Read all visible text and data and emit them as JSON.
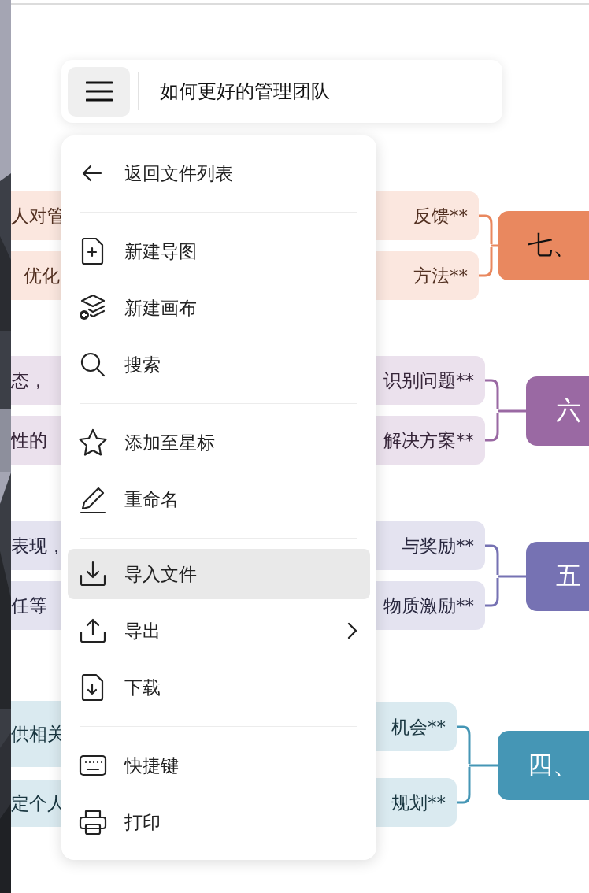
{
  "document": {
    "title": "如何更好的管理团队"
  },
  "menu": [
    {
      "kind": "item",
      "label": "返回文件列表",
      "selected": false
    },
    {
      "kind": "divider"
    },
    {
      "kind": "item",
      "label": "新建导图",
      "selected": false
    },
    {
      "kind": "item",
      "label": "新建画布",
      "selected": false
    },
    {
      "kind": "item",
      "label": "搜索",
      "selected": false
    },
    {
      "kind": "divider"
    },
    {
      "kind": "item",
      "label": "添加至星标",
      "selected": false
    },
    {
      "kind": "item",
      "label": "重命名",
      "selected": false
    },
    {
      "kind": "divider"
    },
    {
      "kind": "item",
      "label": "导入文件",
      "selected": true
    },
    {
      "kind": "item",
      "label": "导出",
      "selected": false,
      "submenu": true
    },
    {
      "kind": "item",
      "label": "下载",
      "selected": false
    },
    {
      "kind": "divider"
    },
    {
      "kind": "item",
      "label": "快捷键",
      "selected": false
    },
    {
      "kind": "item",
      "label": "打印",
      "selected": false
    }
  ],
  "branches": [
    {
      "title": "七、",
      "color": "#e9885f",
      "children": [
        {
          "text": "反馈**"
        },
        {
          "text": "方法**"
        }
      ],
      "details": [
        {
          "text": "人对管"
        },
        {
          "text": "优化"
        }
      ]
    },
    {
      "title": "六",
      "color": "#9a69a3",
      "children": [
        {
          "text": "识别问题**"
        },
        {
          "text": "解决方案**"
        }
      ],
      "details": [
        {
          "text": "态，"
        },
        {
          "text": "性的"
        }
      ]
    },
    {
      "title": "五",
      "color": "#7672b3",
      "children": [
        {
          "text": "与奖励**"
        },
        {
          "text": "物质激励**"
        }
      ],
      "details": [
        {
          "text": "表现，"
        },
        {
          "text": "任等"
        }
      ]
    },
    {
      "title": "四、",
      "color": "#4596b5",
      "children": [
        {
          "text": "机会**"
        },
        {
          "text": "规划**"
        }
      ],
      "details": [
        {
          "text": "供相关"
        },
        {
          "text": "定个人"
        }
      ]
    }
  ]
}
